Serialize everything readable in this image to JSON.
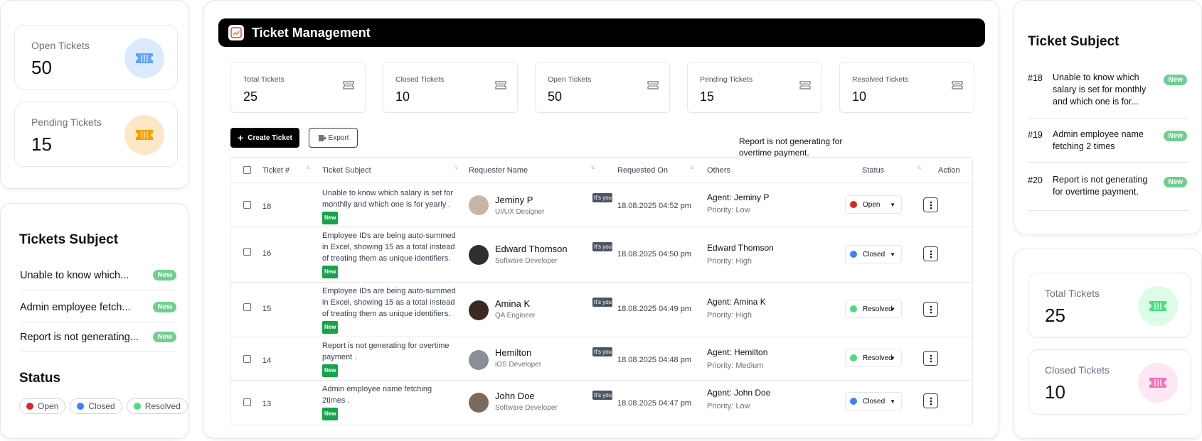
{
  "left_top": {
    "cards": [
      {
        "label": "Open Tickets",
        "value": "50",
        "icon": "ticket-icon",
        "icon_bg": "#dbeafe",
        "icon_color": "#60a5fa"
      },
      {
        "label": "Pending Tickets",
        "value": "15",
        "icon": "ticket-icon",
        "icon_bg": "#fde7c7",
        "icon_color": "#f59e0b"
      }
    ]
  },
  "left_bottom": {
    "subject_title": "Tickets Subject",
    "subjects": [
      {
        "text": "Unable to know which...",
        "badge": "New"
      },
      {
        "text": "Admin employee fetch...",
        "badge": "New"
      },
      {
        "text": "Report is not generating...",
        "badge": "New"
      }
    ],
    "status_title": "Status",
    "statuses": [
      {
        "label": "Open",
        "color": "#dc2626"
      },
      {
        "label": "Closed",
        "color": "#3b82f6"
      },
      {
        "label": "Resolved",
        "color": "#4ade80"
      }
    ]
  },
  "main": {
    "title": "Ticket Management",
    "stats": [
      {
        "label": "Total Tickets",
        "value": "25"
      },
      {
        "label": "Closed Tickets",
        "value": "10"
      },
      {
        "label": "Open Tickets",
        "value": "50"
      },
      {
        "label": "Pending Tickets",
        "value": "15"
      },
      {
        "label": "Resolved Tickets",
        "value": "10"
      }
    ],
    "create_label": "Create Ticket",
    "export_label": "Export",
    "tooltip": "Report is not generating for overtime payment.",
    "columns": [
      "Ticket #",
      "Ticket Subject",
      "Requester Name",
      "Requested On",
      "Others",
      "Status",
      "Action"
    ],
    "rows": [
      {
        "id": "18",
        "subject": "Unable to know which salary is set for monthlly and which one is for yearly .",
        "tag": "New",
        "name": "Jeminy P",
        "role": "UI/UX Designer",
        "you_tag": "It's you",
        "date": "18.08.2025 04:52 pm",
        "agent": "Agent: Jeminy P",
        "priority": "Priority: Low",
        "status": "Open",
        "status_color": "#dc2626",
        "avatar_color": "#c8b5a6"
      },
      {
        "id": "16",
        "subject": "Employee IDs are being auto-summed in Excel, showing 15 as a total instead of treating them as unique identifiers.",
        "tag": "New",
        "name": "Edward Thomson",
        "role": "Software Developer",
        "you_tag": "It's you",
        "date": "18.08.2025 04:50 pm",
        "agent": "Edward Thomson",
        "priority": "Priority: High",
        "status": "Closed",
        "status_color": "#3b82f6",
        "avatar_color": "#2f2f2f"
      },
      {
        "id": "15",
        "subject": "Employee IDs are being auto-summed in Excel, showing 15 as a total instead of treating them as unique identifiers.",
        "tag": "New",
        "name": "Amina K",
        "role": "QA Engineer",
        "you_tag": "It's you",
        "date": "18.08.2025 04:49 pm",
        "agent": "Agent: Amina K",
        "priority": "Priority: High",
        "status": "Resolved",
        "status_color": "#4ade80",
        "avatar_color": "#3a2a22"
      },
      {
        "id": "14",
        "subject": "Report is not generating for overtime payment .",
        "tag": "New",
        "name": "Hemilton",
        "role": "iOS Developer",
        "you_tag": "It's you",
        "date": "18.08.2025 04:48 pm",
        "agent": "Agent: Hemilton",
        "priority": "Priority: Medium",
        "status": "Resolved",
        "status_color": "#4ade80",
        "avatar_color": "#8a8f96"
      },
      {
        "id": "13",
        "subject": "Admin employee name fetching 2times .",
        "tag": "New",
        "name": "John Doe",
        "role": "Software Developer",
        "you_tag": "It's you",
        "date": "18.08.2025 04:47 pm",
        "agent": "Agent: John Doe",
        "priority": "Priority: Low",
        "status": "Closed",
        "status_color": "#3b82f6",
        "avatar_color": "#7a6a5e"
      }
    ]
  },
  "right_top": {
    "title": "Ticket Subject",
    "items": [
      {
        "num": "#18",
        "text": "Unable to know which salary is set for monthly and which one is for...",
        "badge": "New"
      },
      {
        "num": "#19",
        "text": "Admin employee name fetching 2 times",
        "badge": "New"
      },
      {
        "num": "#20",
        "text": "Report is not generating for overtime payment.",
        "badge": "New"
      }
    ]
  },
  "right_bottom": {
    "cards": [
      {
        "label": "Total Tickets",
        "value": "25",
        "icon": "ticket-icon",
        "icon_bg": "#dcfce7",
        "icon_color": "#4ade80"
      },
      {
        "label": "Closed Tickets",
        "value": "10",
        "icon": "ticket-icon",
        "icon_bg": "#fce7f3",
        "icon_color": "#f472b6"
      }
    ]
  }
}
